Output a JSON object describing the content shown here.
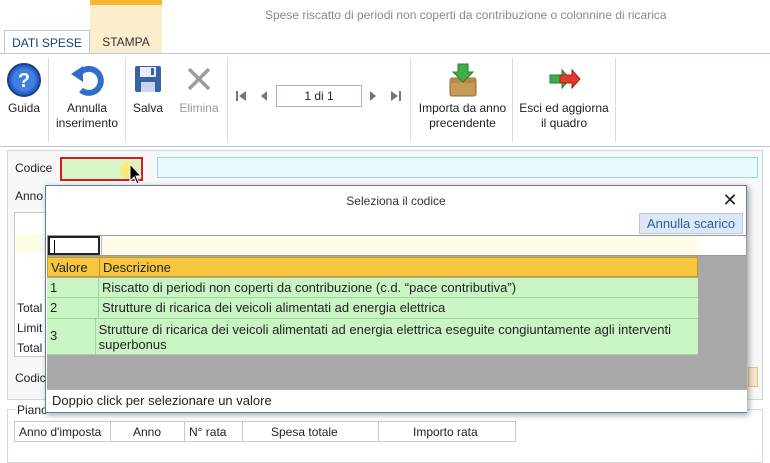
{
  "window": {
    "title": "Spese riscatto di periodi non coperti da contribuzione o colonnine di ricarica"
  },
  "tabs": [
    {
      "label": "DATI SPESE"
    },
    {
      "label": "STAMPA"
    }
  ],
  "toolbar": {
    "guida": "Guida",
    "annulla_l1": "Annulla",
    "annulla_l2": "inserimento",
    "salva": "Salva",
    "elimina": "Elimina",
    "record_position": "1 di 1",
    "importa_l1": "Importa da anno",
    "importa_l2": "precendente",
    "esci_l1": "Esci ed aggiorna",
    "esci_l2": "il quadro"
  },
  "form": {
    "codice_label": "Codice",
    "anno_label": "Anno",
    "total1_label": "Total",
    "limit_label": "Limit",
    "total2_label": "Total",
    "codice2_label": "Codic",
    "piano_label": "Piano"
  },
  "piano_table": {
    "columns": [
      "Anno d'imposta",
      "Anno",
      "N° rata",
      "Spesa totale",
      "Importo rata"
    ]
  },
  "popup": {
    "title": "Seleziona il codice",
    "annulla_scarico": "Annulla scarico",
    "columns": {
      "valore": "Valore",
      "descrizione": "Descrizione"
    },
    "rows": [
      {
        "valore": "1",
        "descrizione": "Riscatto di periodi non coperti da contribuzione (c.d. “pace contributiva”)"
      },
      {
        "valore": "2",
        "descrizione": "Strutture di ricarica dei veicoli alimentati ad energia elettrica"
      },
      {
        "valore": "3",
        "descrizione": "Strutture di ricarica dei veicoli alimentati ad energia elettrica eseguite congiuntamente agli interventi superbonus"
      }
    ],
    "status": "Doppio click per selezionare un valore"
  }
}
